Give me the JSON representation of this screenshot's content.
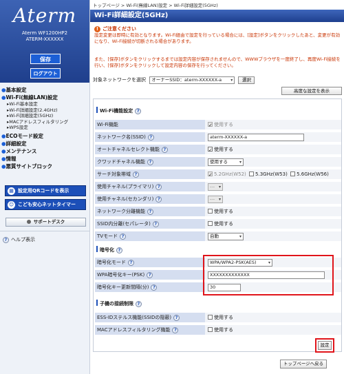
{
  "sidebar": {
    "logo": "Aterm",
    "model_line1": "Aterm  WF1200HP2",
    "model_line2": "ATERM-XXXXXX",
    "save_label": "保存",
    "logout_label": "ログアウト",
    "nav": {
      "basic": "基本設定",
      "wifi": "Wi-Fi(無線LAN)設定",
      "wifi_sub": [
        "Wi-Fi基本設定",
        "Wi-Fi詳細設定(2.4GHz)",
        "Wi-Fi詳細設定(5GHz)",
        "MACアドレスフィルタリング",
        "WPS設定"
      ],
      "eco": "ECOモード設定",
      "detail": "詳細設定",
      "maintenance": "メンテナンス",
      "info": "情報",
      "malware": "悪質サイトブロック"
    },
    "qr_label": "設定用QRコードを表示",
    "kid_label": "こども安心ネットタイマー",
    "support_label": "サポートデスク",
    "help_label": "ヘルプ表示"
  },
  "breadcrumb": "トップページ > Wi-Fi(無線LAN)設定 > Wi-Fi詳細設定(5GHz)",
  "page_title": "Wi-Fi詳細設定(5GHz)",
  "notice": {
    "title": "ご注意ください",
    "text1": "設定変更は即時に有効となります。Wi-Fi経由で設定を行っている場合には、[設定]ボタンをクリックしたあと、変更が有効になり、Wi-Fi接続が切断される場合があります。",
    "text2": "また、[保存]ボタンをクリックするまでは設定内容が保存されませんので、WWWブラウザを一度終了し、再度Wi-Fi接続を行い、[保存]ボタンをクリックして設定内容の保存を行ってください。"
  },
  "target": {
    "label": "対象ネットワークを選択",
    "value": "オーナーSSID：aterm-XXXXXX-a",
    "select_button": "選択"
  },
  "advanced_button": "高度な設定を表示",
  "sections": {
    "wifi_function": "Wi-Fi機能設定",
    "encryption": "暗号化",
    "child": "子機の接続制限"
  },
  "rows": {
    "wifi_feature": {
      "label": "Wi-Fi機能",
      "value": "使用する"
    },
    "ssid": {
      "label": "ネットワーク名(SSID)",
      "value": "aterm-XXXXXX-a"
    },
    "auto_channel": {
      "label": "オートチャネルセレクト機能",
      "value": "使用する"
    },
    "quad_channel": {
      "label": "クワッドチャネル機能",
      "value": "使用する"
    },
    "band": {
      "label": "サーチ対象帯域",
      "options": [
        "5.2GHz(W52)",
        "5.3GHz(W53)",
        "5.6GHz(W56)"
      ]
    },
    "primary_channel": {
      "label": "使用チャネル(プライマリ)",
      "value": "---"
    },
    "secondary_channel": {
      "label": "使用チャネル(セカンダリ)",
      "value": "---"
    },
    "separator": {
      "label": "ネットワーク分離機能",
      "value": "使用する"
    },
    "ssid_separator": {
      "label": "SSID内分離(セパレータ)",
      "value": "使用する"
    },
    "tv_mode": {
      "label": "TVモード",
      "value": "自動"
    },
    "enc_mode": {
      "label": "暗号化モード",
      "value": "WPA/WPA2-PSK(AES)"
    },
    "psk": {
      "label": "WPA暗号化キー(PSK)",
      "value": "XXXXXXXXXXXXX"
    },
    "interval": {
      "label": "暗号化キー更新間隔(分)",
      "value": "30"
    },
    "stealth": {
      "label": "ESS-IDステルス機能(SSIDの隠蔽)",
      "value": "使用する"
    },
    "mac_filter": {
      "label": "MACアドレスフィルタリング機能",
      "value": "使用する"
    }
  },
  "apply_button": "設定",
  "top_button": "トップページへ戻る"
}
